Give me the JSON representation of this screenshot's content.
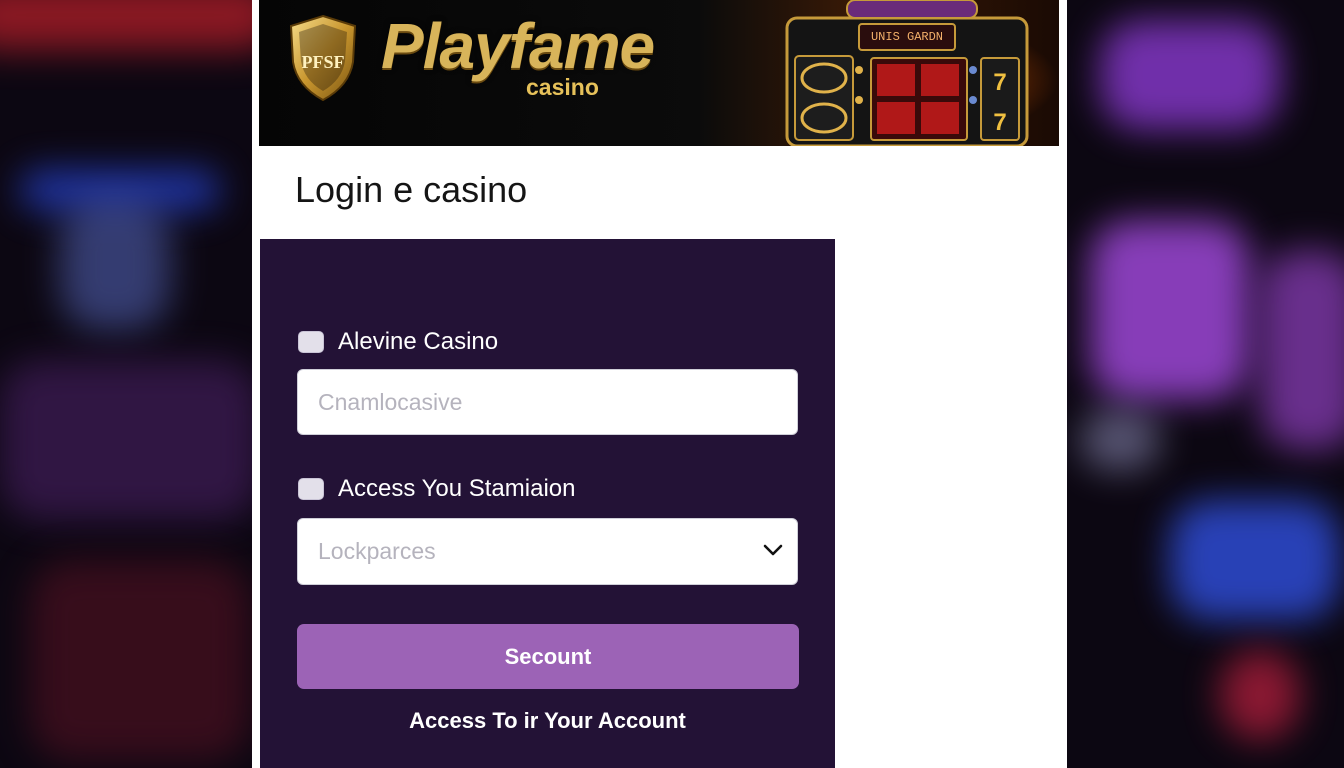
{
  "brand": {
    "name": "Playfame",
    "sub": "casino",
    "shield_text": "PFSF",
    "slot_screen": "UNIS GARDN"
  },
  "page": {
    "title": "Login e casino"
  },
  "form": {
    "casino_label": "Alevine Casino",
    "casino_placeholder": "Cnamlocasive",
    "station_label": "Access You Stamiaion",
    "station_placeholder": "Lockparces",
    "submit_label": "Secount",
    "account_link": "Access To ir Your Account"
  },
  "colors": {
    "card": "#231236",
    "button": "#9c63b6",
    "brand_gold": "#d8b45a"
  }
}
